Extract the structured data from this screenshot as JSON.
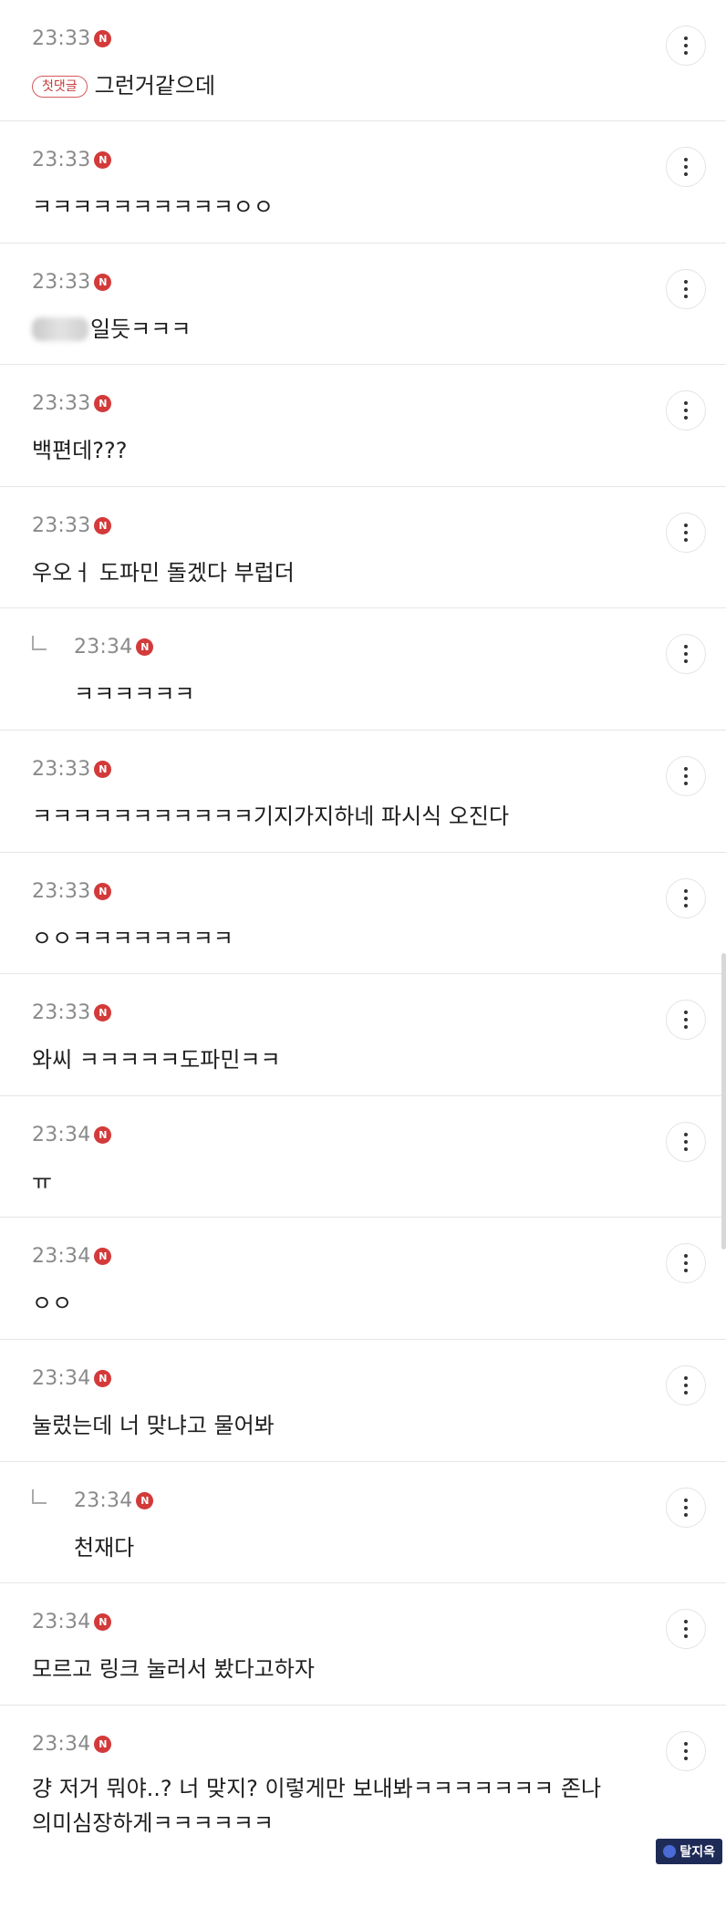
{
  "comments": [
    {
      "time": "23:33",
      "badge": "N",
      "tag": "첫댓글",
      "text": "그런거같으데",
      "reply": false
    },
    {
      "time": "23:33",
      "badge": "N",
      "text": "ㅋㅋㅋㅋㅋㅋㅋㅋㅋㅋㅇㅇ",
      "reply": false
    },
    {
      "time": "23:33",
      "badge": "N",
      "text": "일듯ㅋㅋㅋ",
      "redacted": true,
      "reply": false
    },
    {
      "time": "23:33",
      "badge": "N",
      "text": "백편데???",
      "reply": false
    },
    {
      "time": "23:33",
      "badge": "N",
      "text": "우오ㅓ 도파민 돌겠다 부럽더",
      "reply": false
    },
    {
      "time": "23:34",
      "badge": "N",
      "text": "ㅋㅋㅋㅋㅋㅋ",
      "reply": true
    },
    {
      "time": "23:33",
      "badge": "N",
      "text": "ㅋㅋㅋㅋㅋㅋㅋㅋㅋㅋㅋ기지가지하네 파시식 오진다",
      "reply": false
    },
    {
      "time": "23:33",
      "badge": "N",
      "text": "ㅇㅇㅋㅋㅋㅋㅋㅋㅋㅋ",
      "reply": false
    },
    {
      "time": "23:33",
      "badge": "N",
      "text": "와씨 ㅋㅋㅋㅋㅋ도파민ㅋㅋ",
      "reply": false
    },
    {
      "time": "23:34",
      "badge": "N",
      "text": "ㅠ",
      "reply": false
    },
    {
      "time": "23:34",
      "badge": "N",
      "text": "ㅇㅇ",
      "reply": false
    },
    {
      "time": "23:34",
      "badge": "N",
      "text": "눌렀는데 너 맞냐고 물어봐",
      "reply": false
    },
    {
      "time": "23:34",
      "badge": "N",
      "text": "천재다",
      "reply": true
    },
    {
      "time": "23:34",
      "badge": "N",
      "text": "모르고 링크 눌러서 봤다고하자",
      "reply": false
    },
    {
      "time": "23:34",
      "badge": "N",
      "text": "걍 저거 뭐야..? 너 맞지? 이렇게만 보내봐ㅋㅋㅋㅋㅋㅋㅋ 존나",
      "text2": "의미심장하게ㅋㅋㅋㅋㅋㅋ",
      "reply": false
    }
  ],
  "icons": {
    "more": "more-vertical-icon",
    "reply": "reply-arrow-icon",
    "badge": "new-badge-icon"
  },
  "colors": {
    "badge": "#d33a3a",
    "tag_border": "#d35a5a",
    "divider": "#e6e6e6"
  },
  "watermark": {
    "text": "탈지옥"
  }
}
